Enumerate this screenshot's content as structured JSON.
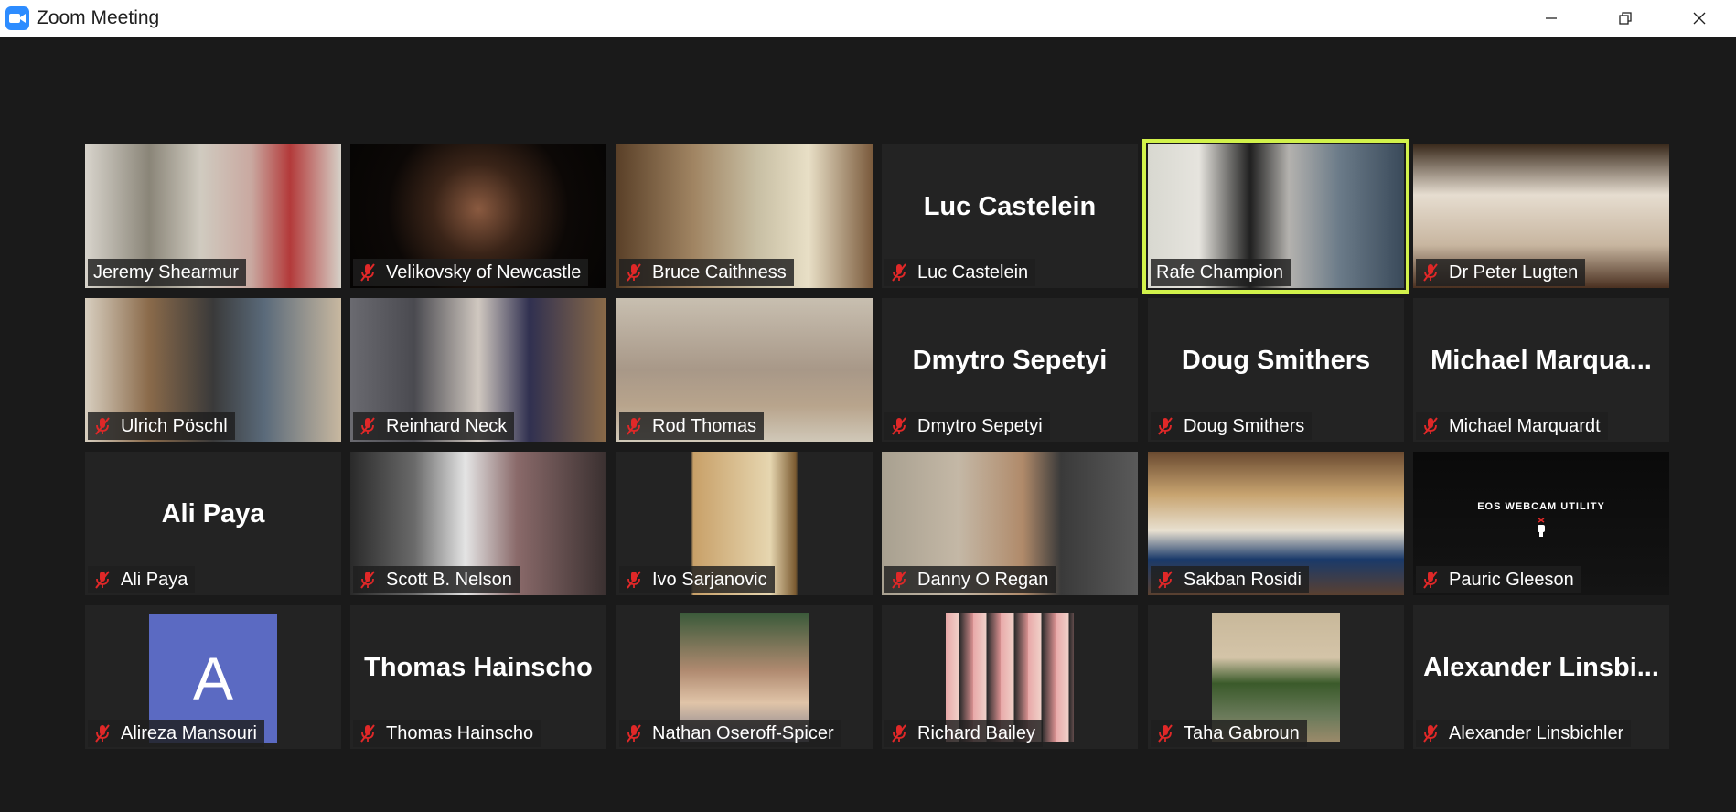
{
  "window": {
    "title": "Zoom Meeting",
    "app_icon": "zoom-camera-icon",
    "controls": [
      "minimize-icon",
      "restore-icon",
      "close-icon"
    ]
  },
  "colors": {
    "active_speaker_border": "#d2f24b",
    "mute_icon": "#e02828",
    "avatar_bg": "#5b6ac2",
    "tile_bg": "#232323",
    "stage_bg": "#1a1a1a"
  },
  "participants": [
    {
      "name": "Jeremy Shearmur",
      "muted": false,
      "video": true
    },
    {
      "name": "Velikovsky of Newcastle",
      "muted": true,
      "video": true
    },
    {
      "name": "Bruce Caithness",
      "muted": true,
      "video": true
    },
    {
      "name": "Luc Castelein",
      "muted": true,
      "video": false,
      "display_name": "Luc Castelein"
    },
    {
      "name": "Rafe Champion",
      "muted": false,
      "video": true,
      "active_speaker": true
    },
    {
      "name": "Dr Peter Lugten",
      "muted": true,
      "video": true
    },
    {
      "name": "Ulrich Pöschl",
      "muted": true,
      "video": true
    },
    {
      "name": "Reinhard Neck",
      "muted": true,
      "video": true
    },
    {
      "name": "Rod Thomas",
      "muted": true,
      "video": true
    },
    {
      "name": "Dmytro Sepetyi",
      "muted": true,
      "video": false,
      "display_name": "Dmytro Sepetyi"
    },
    {
      "name": "Doug Smithers",
      "muted": true,
      "video": false,
      "display_name": "Doug Smithers"
    },
    {
      "name": "Michael Marquardt",
      "muted": true,
      "video": false,
      "display_name": "Michael  Marqua..."
    },
    {
      "name": "Ali Paya",
      "muted": true,
      "video": false,
      "display_name": "Ali Paya"
    },
    {
      "name": "Scott B. Nelson",
      "muted": true,
      "video": true
    },
    {
      "name": "Ivo Sarjanovic",
      "muted": true,
      "video": true
    },
    {
      "name": "Danny O Regan",
      "muted": true,
      "video": true
    },
    {
      "name": "Sakban Rosidi",
      "muted": true,
      "video": true
    },
    {
      "name": "Pauric Gleeson",
      "muted": true,
      "video": true,
      "overlay_text": "EOS WEBCAM UTILITY"
    },
    {
      "name": "Alireza Mansouri",
      "muted": true,
      "video": false,
      "avatar_letter": "A"
    },
    {
      "name": "Thomas Hainscho",
      "muted": true,
      "video": false,
      "display_name": "Thomas Hainscho"
    },
    {
      "name": "Nathan Oseroff-Spicer",
      "muted": true,
      "video": false,
      "profile_photo": true
    },
    {
      "name": "Richard Bailey",
      "muted": true,
      "video": false,
      "profile_photo": true
    },
    {
      "name": "Taha Gabroun",
      "muted": true,
      "video": false,
      "profile_photo": true
    },
    {
      "name": "Alexander Linsbichler",
      "muted": true,
      "video": false,
      "display_name": "Alexander  Linsbi..."
    }
  ]
}
